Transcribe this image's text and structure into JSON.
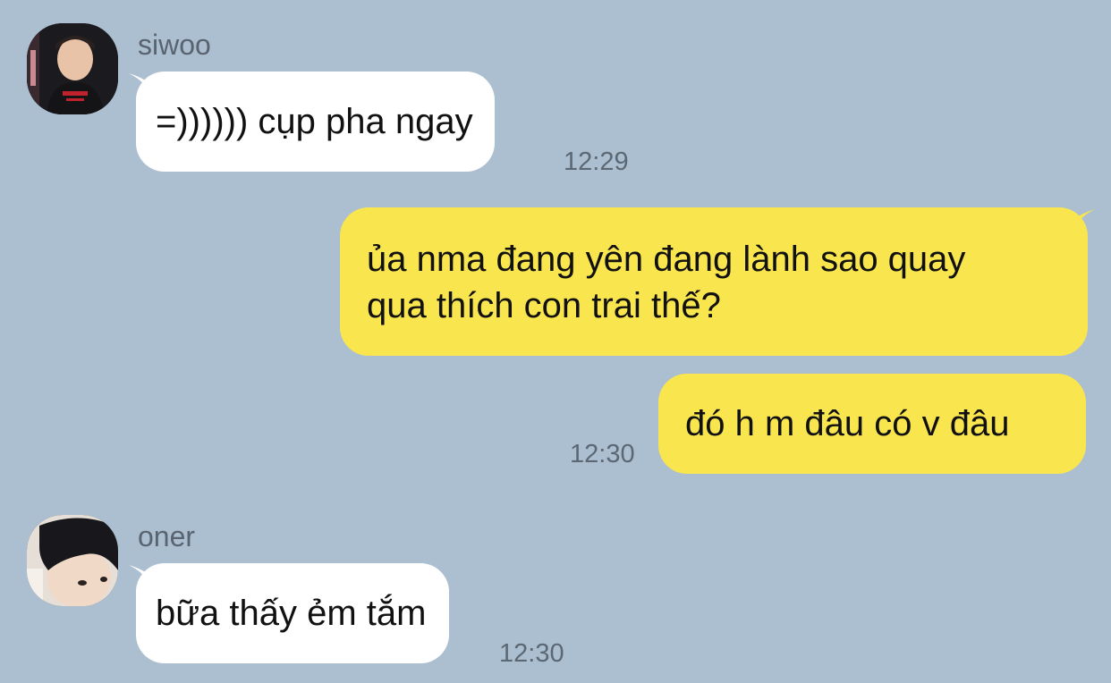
{
  "colors": {
    "background": "#acbfd0",
    "incoming_bubble": "#ffffff",
    "outgoing_bubble": "#f9e54e",
    "sender_name": "#5a6470",
    "timestamp": "#5c6873"
  },
  "messages": [
    {
      "direction": "incoming",
      "sender": "siwoo",
      "avatar_icon": "user-avatar-photo",
      "lines": [
        "=)))))) cụp pha ngay"
      ],
      "time": "12:29"
    },
    {
      "direction": "outgoing",
      "lines": [
        "ủa nma đang yên đang lành sao quay",
        "qua thích con trai thế?"
      ],
      "time": ""
    },
    {
      "direction": "outgoing",
      "lines": [
        "đó h m đâu có v đâu"
      ],
      "time": "12:30"
    },
    {
      "direction": "incoming",
      "sender": "oner",
      "avatar_icon": "user-avatar-photo",
      "lines": [
        "bữa thấy ẻm tắm"
      ],
      "time": "12:30"
    }
  ]
}
